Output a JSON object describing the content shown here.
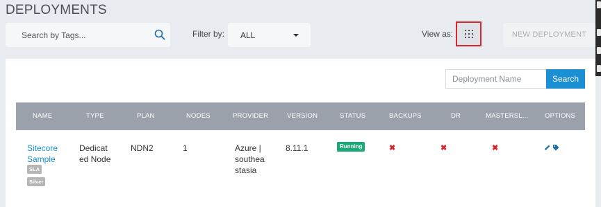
{
  "header": {
    "title": "DEPLOYMENTS"
  },
  "toolbar": {
    "search_placeholder": "Search by Tags...",
    "filter_label": "Filter by:",
    "filter_value": "ALL",
    "view_label": "View as:",
    "new_deployment_label": "NEW DEPLOYMENT"
  },
  "panel": {
    "deployment_name_placeholder": "Deployment Name",
    "search_button_label": "Search"
  },
  "table": {
    "columns": [
      "NAME",
      "TYPE",
      "PLAN",
      "NODES",
      "PROVIDER",
      "VERSION",
      "STATUS",
      "BACKUPS",
      "DR",
      "MASTERSL...",
      "OPTIONS"
    ],
    "rows": [
      {
        "name_line1": "Sitecore",
        "name_line2": "Sample",
        "tags": [
          "SLA",
          "Silver"
        ],
        "type_line1": "Dedicat",
        "type_line2": "ed Node",
        "plan": "NDN2",
        "nodes": "1",
        "provider_line1": "Azure |",
        "provider_line2": "southea",
        "provider_line3": "stasia",
        "version": "8.11.1",
        "status": "Running",
        "backups": "✖",
        "dr": "✖",
        "masterslave": "✖"
      }
    ]
  },
  "colors": {
    "accent": "#1a8fd3",
    "running": "#19a974",
    "error": "#d9262c",
    "header_bg": "#9ba1ab"
  },
  "icons": [
    "search-icon",
    "grid-view-icon",
    "edit-pencil-icon",
    "tag-icon",
    "x-icon"
  ]
}
